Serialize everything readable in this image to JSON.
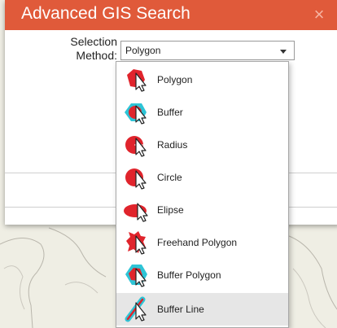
{
  "dialog": {
    "title": "Advanced GIS Search",
    "close_glyph": "×"
  },
  "selection": {
    "label_line1": "Selection",
    "label_line2": "Method:",
    "value": "Polygon"
  },
  "options": [
    {
      "label": "Polygon",
      "icon": "polygon-select-icon"
    },
    {
      "label": "Buffer",
      "icon": "buffer-select-icon"
    },
    {
      "label": "Radius",
      "icon": "radius-select-icon"
    },
    {
      "label": "Circle",
      "icon": "circle-select-icon"
    },
    {
      "label": "Elipse",
      "icon": "ellipse-select-icon"
    },
    {
      "label": "Freehand Polygon",
      "icon": "freehand-polygon-select-icon"
    },
    {
      "label": "Buffer Polygon",
      "icon": "buffer-polygon-select-icon"
    },
    {
      "label": "Buffer Line",
      "icon": "buffer-line-select-icon",
      "highlighted": true
    }
  ],
  "colors": {
    "accent": "#e05a3a",
    "icon_red": "#e0242c",
    "icon_cyan": "#2ec4d6",
    "map_bg": "#efeee4"
  }
}
